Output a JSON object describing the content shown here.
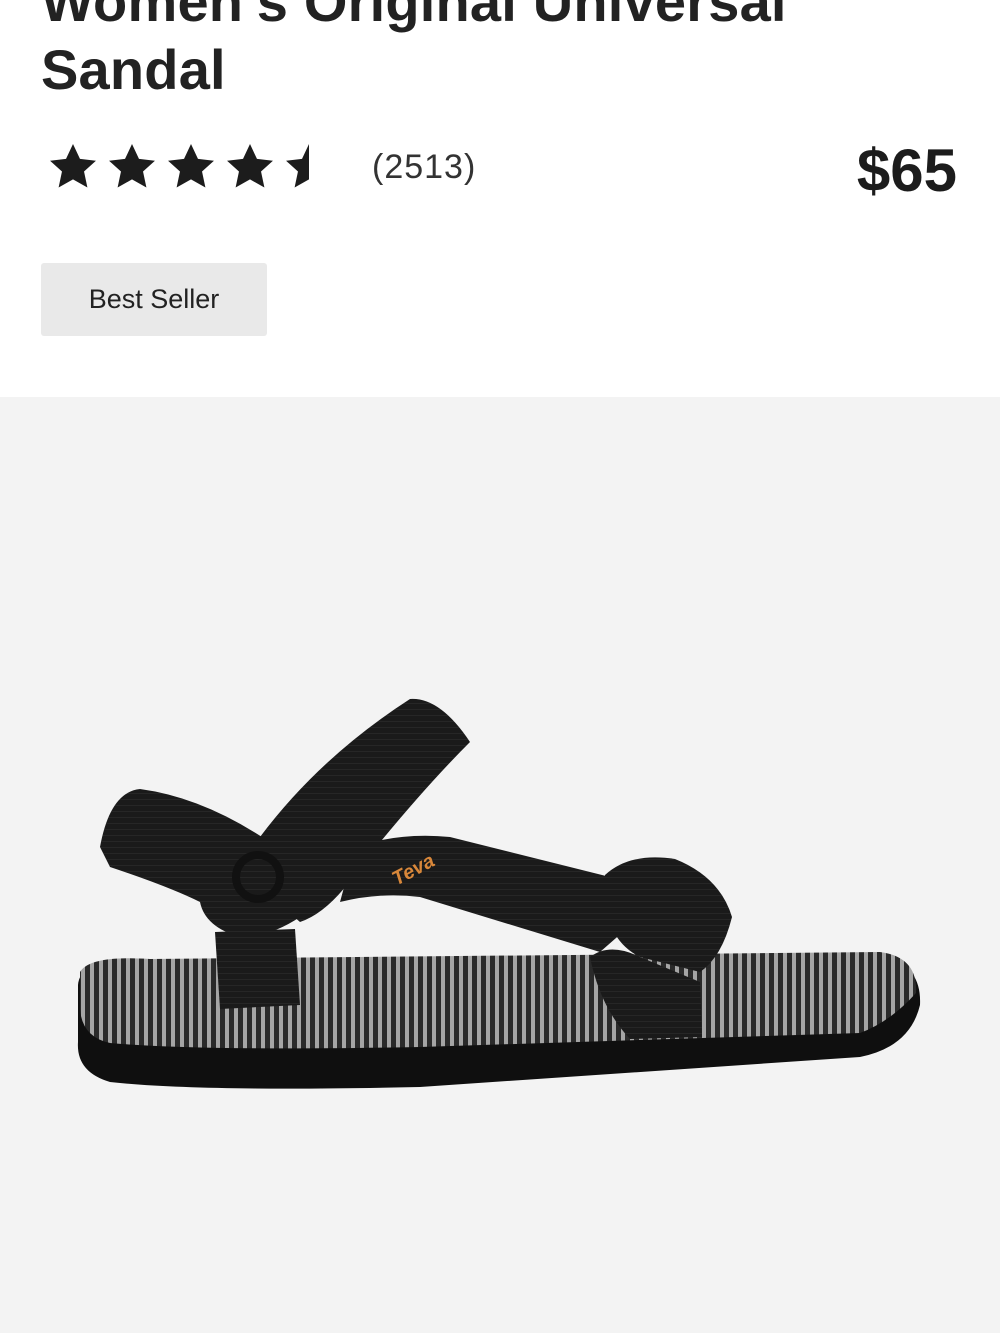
{
  "product": {
    "title_line1": "Women's Original Universal",
    "title_line2": "Sandal",
    "rating": 4.5,
    "rating_max": 5,
    "review_count": "(2513)",
    "price": "$65",
    "badge": "Best Seller",
    "image": {
      "subject": "black sandal",
      "logo_text": "Teva",
      "colors": {
        "strap": "#1a1a1a",
        "sole": "#0f0f0f",
        "footbed_stripe": "#9a9a9a",
        "logo": "#d8873a"
      }
    }
  }
}
